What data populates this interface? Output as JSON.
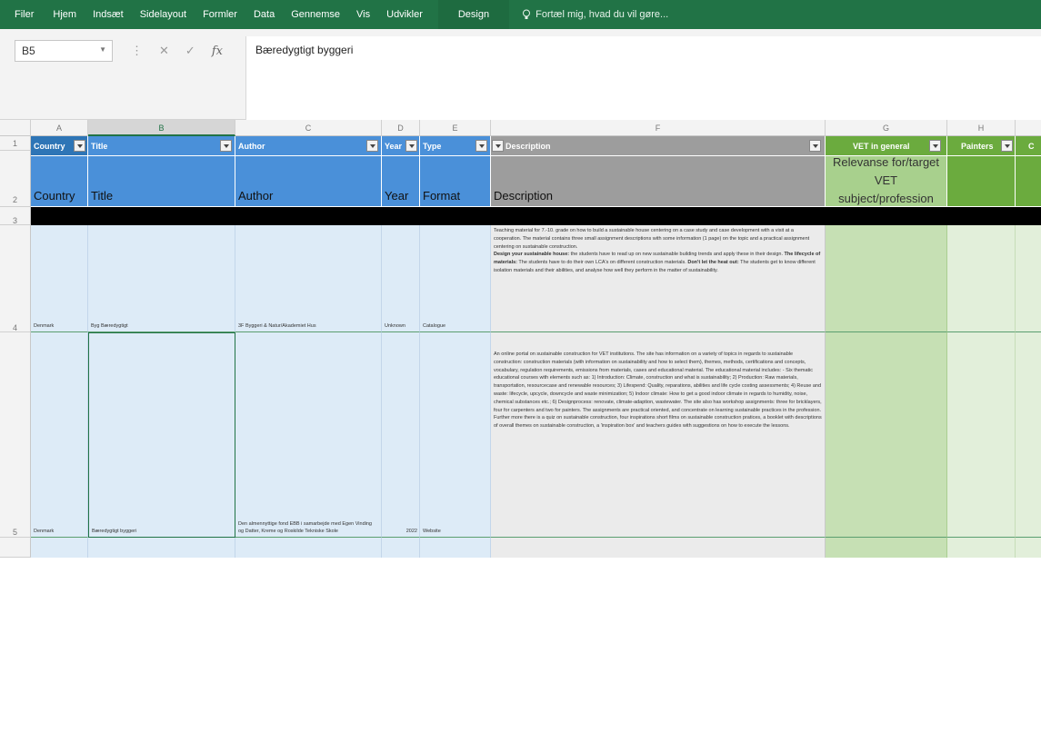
{
  "ribbon": {
    "tabs": [
      "Filer",
      "Hjem",
      "Indsæt",
      "Sidelayout",
      "Formler",
      "Data",
      "Gennemse",
      "Vis",
      "Udvikler"
    ],
    "context_tab": "Design",
    "tell_me": "Fortæl mig, hvad du vil gøre..."
  },
  "formula_bar": {
    "name_box": "B5",
    "content": "Bæredygtigt byggeri"
  },
  "columns": [
    "A",
    "B",
    "C",
    "D",
    "E",
    "F",
    "G",
    "H"
  ],
  "row_numbers": [
    "1",
    "2",
    "3",
    "4",
    "5"
  ],
  "header_row1": {
    "country": "Country",
    "title": "Title",
    "author": "Author",
    "year": "Year",
    "type": "Type",
    "description": "Description",
    "vet": "VET in general",
    "painters": "Painters",
    "extra": "C"
  },
  "header_row2": {
    "country": "Country",
    "title": "Title",
    "author": "Author",
    "year": "Year",
    "format": "Format",
    "description": "Description",
    "relevance": "Relevanse for/target VET subject/profession"
  },
  "rows": [
    {
      "country": "Denmark",
      "title": "Byg Bæredygtigt",
      "author": "3F Byggeri & Natur/Akademiet Hus",
      "year": "Unknown",
      "format": "Catalogue",
      "desc_intro": "Teaching material for 7.-10. grade on how to build a sustainable house centering on a case study and case development with a visit at a cooperation. The material contains three small assignment descriptions with some information (1 page) on the topic and a practical assignment centering on sustainable construction.",
      "desc_b1": "Design your sustainable house:",
      "desc_t1": " the students have to read up on new sustainable building trends and apply these in their design.",
      "desc_b2": "The lifecycle of materials:",
      "desc_t2": " The students have to do their own LCA's on different construction materials.",
      "desc_b3": "Don't let the heat out:",
      "desc_t3": " The students get to know different isolation materials and their abilities, and analyse how well they perform in the matter of sustainability."
    },
    {
      "country": "Denmark",
      "title": "Bæredygtigt byggeri",
      "author": "Den almennyttige fond EBB i samarbejde med Egen Vinding og Datter, Kreme og Roskilde Tekniske Skole",
      "year": "2022",
      "format": "Website",
      "description": "An online portal on sustainable construction for VET institutions. The site has information on a variety of topics in regards to sustainable construction: construction materials (with information on sustainability and how to select them), themes, methods, certifications and concepts, vocabulary, regulation requirements, emissions from materials, cases and educational material. The educational material includes: - Six thematic educational courses with elements such as: 1) Introduction: Climate, construction and what is sustainability; 2) Production: Raw materials, transportation, resourcecase and renewable resources; 3) Lifespend: Quality, reparations, abilities and life cycle costing assessments; 4) Reuse and waste: lifecycle, upcycle, downcycle and waste minimization; 5) Indoor climate: How to get a good indoor climate in regards to humidity, noise, chemical substances etc.; 6) Designprocess: renovate, climate-adaption, wastewater. The site also has workshop assignments: three for bricklayers, four for carpenters and two for painters. The assignments are practical oriented, and concentrate on learning sustainable practices in the profession. Further more there is a quiz on sustainable construction, four inspirations short films on sustainable construction pratices, a booklet with descriptions of overall themes on sustainable construction, a 'inspiration box' and teachers guides with suggestions on how to execute the lessons."
    }
  ]
}
